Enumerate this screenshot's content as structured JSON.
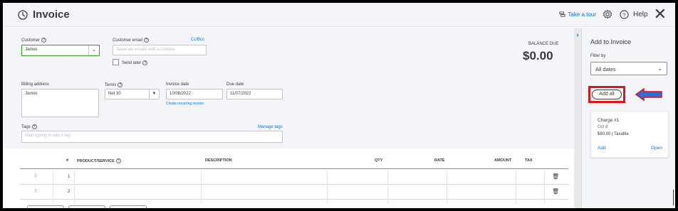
{
  "header": {
    "title": "Invoice",
    "take_tour": "Take a tour",
    "help": "Help"
  },
  "form": {
    "customer_label": "Customer",
    "customer_value": "James",
    "customer_email_label": "Customer email",
    "email_placeholder": "Separate emails with a comma",
    "cc_bcc": "Cc/Bcc",
    "send_later": "Send later",
    "balance_due_label": "BALANCE DUE",
    "balance_due_value": "$0.00",
    "billing_address_label": "Billing address",
    "billing_address_value": "James",
    "terms_label": "Terms",
    "terms_value": "Net 30",
    "invoice_date_label": "Invoice date",
    "invoice_date_value": "10/08/2022",
    "create_recurring": "Create recurring invoice",
    "due_date_label": "Due date",
    "due_date_value": "11/07/2022",
    "tags_label": "Tags",
    "manage_tags": "Manage tags",
    "tags_placeholder": "Start typing to add a tag"
  },
  "table": {
    "columns": [
      "#",
      "PRODUCT/SERVICE",
      "DESCRIPTION",
      "QTY",
      "RATE",
      "AMOUNT",
      "TAX"
    ],
    "rows": [
      {
        "num": "1"
      },
      {
        "num": "2"
      }
    ]
  },
  "panel": {
    "title": "Add to Invoice",
    "filter_label": "Filter by",
    "filter_value": "All dates",
    "add_all": "Add all",
    "charge": {
      "title": "Charge #1",
      "date": "Oct 8",
      "amount": "$80.00 | Taxable",
      "add": "Add",
      "open": "Open"
    }
  },
  "colors": {
    "accent": "#0077c5",
    "highlight": "#e0131b",
    "arrow": "#2d6fd2",
    "customer_border": "#2ca01c"
  }
}
